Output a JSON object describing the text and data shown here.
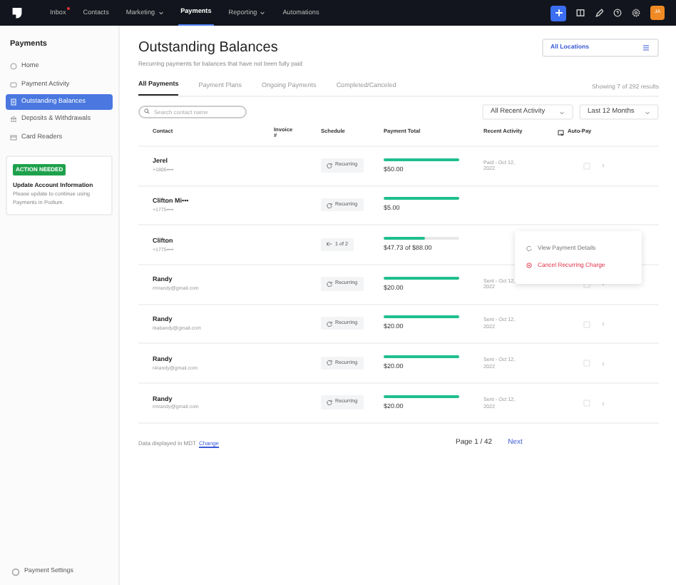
{
  "topnav": {
    "items": [
      {
        "label": "Inbox",
        "selected": false,
        "dropdown": false,
        "dot": true
      },
      {
        "label": "Contacts",
        "selected": false,
        "dropdown": false,
        "dot": false
      },
      {
        "label": "Marketing",
        "selected": false,
        "dropdown": true,
        "dot": false
      },
      {
        "label": "Payments",
        "selected": true,
        "dropdown": false,
        "dot": false
      },
      {
        "label": "Reporting",
        "selected": false,
        "dropdown": true,
        "dot": false
      },
      {
        "label": "Automations",
        "selected": false,
        "dropdown": false,
        "dot": false
      }
    ],
    "avatar": "JA"
  },
  "sidebar": {
    "title": "Payments",
    "items": [
      {
        "label": "Home",
        "selected": false
      },
      {
        "label": "Payment Activity",
        "selected": false
      },
      {
        "label": "Outstanding Balances",
        "selected": true
      },
      {
        "label": "Deposits & Withdrawals",
        "selected": false
      },
      {
        "label": "Card Readers",
        "selected": false
      }
    ],
    "notice": {
      "badge": "ACTION NEEDED",
      "title": "Update Account Information",
      "text": "Please update to continue using Payments in Podium."
    },
    "settings": "Payment Settings"
  },
  "header": {
    "title": "Outstanding Balances",
    "subtitle": "Recurring payments for balances that have not been fully paid",
    "location": "All Locations"
  },
  "tabs": [
    {
      "label": "All Payments",
      "selected": true
    },
    {
      "label": "Payment Plans",
      "selected": false
    },
    {
      "label": "Ongoing Payments",
      "selected": false
    },
    {
      "label": "Completed/Canceled",
      "selected": false
    }
  ],
  "results": "Showing 7 of 292 results",
  "search": {
    "placeholder": "Search contact name"
  },
  "filters": [
    "All Recent Activity",
    "Last 12 Months"
  ],
  "table": {
    "columns": [
      "Contact",
      "Invoice #",
      "Schedule",
      "Payment Total",
      "Recent Activity",
      "Auto-Pay"
    ],
    "rows": [
      {
        "name": "Jerel",
        "sub": "+1806••••",
        "schedule": "Recurring",
        "kind": "recurring",
        "level": 1,
        "total": "$50.00",
        "activity": "Paid - Oct 12, 2022",
        "auto_pay": false
      },
      {
        "name": "Clifton Mi•••",
        "sub": "+1775••••",
        "schedule": "Recurring",
        "kind": "recurring",
        "level": 1,
        "total": "$5.00"
      },
      {
        "name": "Clifton",
        "sub": "+1775••••",
        "schedule": "1 of 2",
        "kind": "plan",
        "level": 0.54,
        "total": "$47.73 of $88.00"
      },
      {
        "name": "Randy",
        "sub": "rmrandy@gmail.com",
        "schedule": "Recurring",
        "kind": "recurring",
        "level": 1,
        "total": "$20.00",
        "activity": "Sent - Oct 12, 2022",
        "auto_pay": false
      },
      {
        "name": "Randy",
        "sub": "rkabandy@gmail.com",
        "schedule": "Recurring",
        "kind": "recurring",
        "level": 1,
        "total": "$20.00",
        "activity": "Sent - Oct 12, 2022",
        "auto_pay": false
      },
      {
        "name": "Randy",
        "sub": "r4randy@gmail.com",
        "schedule": "Recurring",
        "kind": "recurring",
        "level": 1,
        "total": "$20.00",
        "activity": "Sent - Oct 12, 2022",
        "auto_pay": false
      },
      {
        "name": "Randy",
        "sub": "rmrandy@gmail.com",
        "schedule": "Recurring",
        "kind": "recurring",
        "level": 1,
        "total": "$20.00",
        "activity": "Sent - Oct 12, 2022",
        "auto_pay": false
      }
    ]
  },
  "menu": {
    "items": [
      {
        "label": "View Payment Details",
        "kind": "normal"
      },
      {
        "label": "Cancel Recurring Charge",
        "kind": "danger"
      }
    ]
  },
  "footer": {
    "note": "Data displayed in MDT",
    "link": "Change",
    "page": "Page 1 / 42",
    "next": "Next"
  }
}
